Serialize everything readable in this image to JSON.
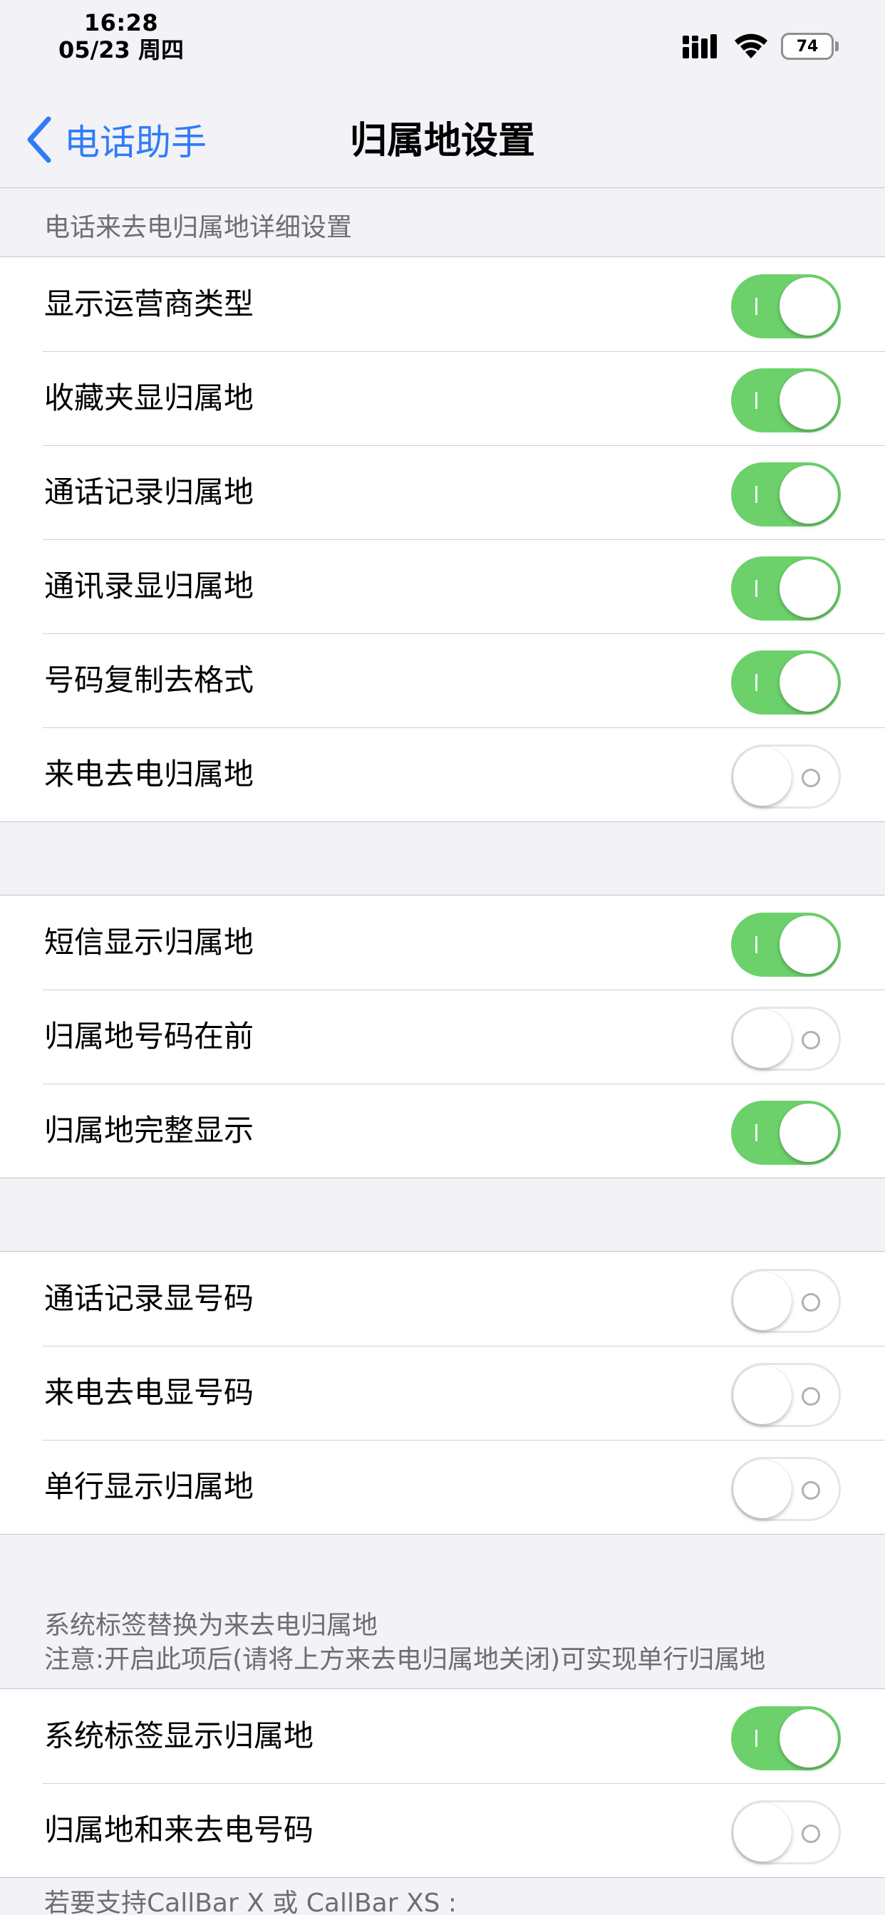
{
  "status_bar": {
    "time": "16:28",
    "date": "05/23 周四",
    "battery": "74"
  },
  "nav": {
    "back_label": "电话助手",
    "title": "归属地设置"
  },
  "section1": {
    "header": "电话来去电归属地详细设置",
    "rows": [
      {
        "label": "显示运营商类型",
        "on": true
      },
      {
        "label": "收藏夹显归属地",
        "on": true
      },
      {
        "label": "通话记录归属地",
        "on": true
      },
      {
        "label": "通讯录显归属地",
        "on": true
      },
      {
        "label": "号码复制去格式",
        "on": true
      },
      {
        "label": "来电去电归属地",
        "on": false
      }
    ]
  },
  "section2": {
    "rows": [
      {
        "label": "短信显示归属地",
        "on": true
      },
      {
        "label": "归属地号码在前",
        "on": false
      },
      {
        "label": "归属地完整显示",
        "on": true
      }
    ]
  },
  "section3": {
    "rows": [
      {
        "label": "通话记录显号码",
        "on": false
      },
      {
        "label": "来电去电显号码",
        "on": false
      },
      {
        "label": "单行显示归属地",
        "on": false
      }
    ]
  },
  "section4": {
    "header_line1": "系统标签替换为来去电归属地",
    "header_line2": "注意:开启此项后(请将上方来去电归属地关闭)可实现单行归属地",
    "rows": [
      {
        "label": "系统标签显示归属地",
        "on": true
      },
      {
        "label": "归属地和来去电号码",
        "on": false
      }
    ]
  },
  "footer_partial": "若要支持CallBar X 或 CallBar XS :",
  "colors": {
    "accent": "#2f7cf6",
    "toggle_on": "#6cd16b",
    "background": "#f2f2f7"
  }
}
